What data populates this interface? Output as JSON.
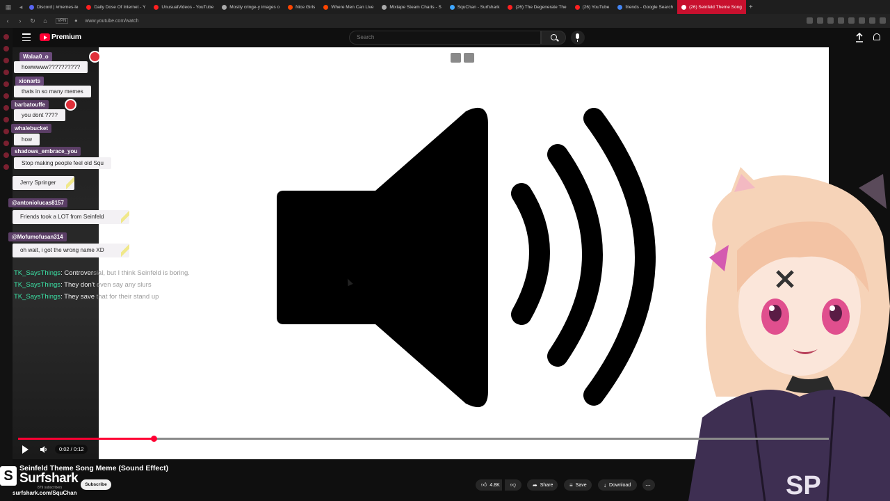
{
  "browser": {
    "tabs": [
      {
        "label": "Discord | #memes-le",
        "color": "#5865f2"
      },
      {
        "label": "Daily Dose Of Internet - Y",
        "color": "#ff2020"
      },
      {
        "label": "UnusualVideos - YouTube",
        "color": "#ff2020"
      },
      {
        "label": "Mostly cringe-y images o",
        "color": "#aaaaaa"
      },
      {
        "label": "Nice Girls",
        "color": "#ff4500"
      },
      {
        "label": "Where Men Can Live",
        "color": "#ff4500"
      },
      {
        "label": "Mixtape Steam Charts - S",
        "color": "#aaaaaa"
      },
      {
        "label": "SquChan - Surfshark",
        "color": "#3ea6ff"
      },
      {
        "label": "(26) The Degenerate The",
        "color": "#ff2020"
      },
      {
        "label": "(26) YouTube",
        "color": "#ff2020"
      },
      {
        "label": "friends - Google Search",
        "color": "#4285f4"
      },
      {
        "label": "(26) Seinfeld Theme Song",
        "color": "#ffffff",
        "active": true
      }
    ],
    "vpn_label": "VPN",
    "url": "www.youtube.com/watch"
  },
  "masthead": {
    "brand": "Premium",
    "search_placeholder": "Search"
  },
  "chat": {
    "messages": [
      {
        "user": "Walaa0_o",
        "text": "howwwww??????????"
      },
      {
        "user": "xionarts",
        "text": "thats in so many memes"
      },
      {
        "user": "barbatouffe",
        "text": "you dont ????"
      },
      {
        "user": "whalebucket",
        "text": "how"
      },
      {
        "user": "shadows_embrace_you",
        "text": "Stop making people feel old Squ"
      },
      {
        "user": "",
        "text": "Jerry Springer"
      },
      {
        "user": "@antoniolucas8157",
        "text": "Friends took a LOT from Seinfeld"
      },
      {
        "user": "@Mofumofusan314",
        "text": "oh wait, i got the wrong name XD"
      }
    ],
    "plain_lines": [
      {
        "user": "TK_SaysThings",
        "text_bright": "Controver",
        "text_faded": "sial, but I think Seinfeld is boring."
      },
      {
        "user": "TK_SaysThings",
        "text_bright": "They don't",
        "text_faded": " even say any slurs"
      },
      {
        "user": "TK_SaysThings",
        "text_bright": "They save",
        "text_faded": " that for their stand up"
      }
    ]
  },
  "player": {
    "time": "0:02 / 0:12",
    "progress_fraction": 0.167
  },
  "video": {
    "title": "Seinfeld Theme Song Meme (Sound Effect)",
    "channel_word": "Surfshark",
    "subscribers": "879 subscribers",
    "subscribe_label": "Subscribe",
    "overlay_url": "surfshark.com/SquChan"
  },
  "actions": {
    "likes": "4.8K",
    "share": "Share",
    "save": "Save",
    "download": "Download"
  }
}
